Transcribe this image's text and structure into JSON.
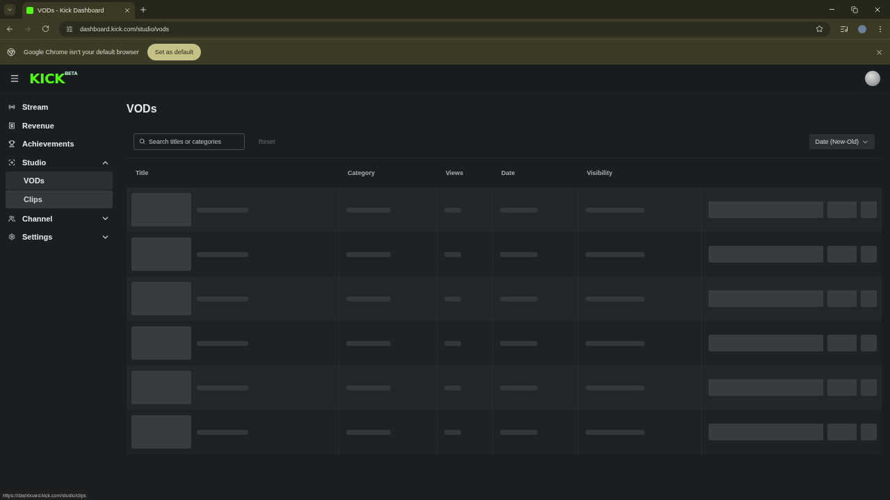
{
  "browser": {
    "tab": {
      "title": "VODs - Kick Dashboard",
      "selected": true
    },
    "url": "dashboard.kick.com/studio/vods",
    "infobar": {
      "message": "Google Chrome isn't your default browser",
      "button": "Set as default"
    },
    "status_url": "https://dashboard.kick.com/studio/clips"
  },
  "header": {
    "logo": "KICK",
    "logo_badge": "BETA"
  },
  "sidebar": {
    "items": [
      {
        "label": "Stream",
        "kind": "stream"
      },
      {
        "label": "Revenue",
        "kind": "revenue"
      },
      {
        "label": "Achievements",
        "kind": "achievements"
      },
      {
        "label": "Studio",
        "kind": "studio",
        "expanded": true,
        "children": [
          {
            "label": "VODs",
            "selected": true,
            "hovered": false
          },
          {
            "label": "Clips",
            "selected": false,
            "hovered": true
          }
        ]
      },
      {
        "label": "Channel",
        "kind": "channel",
        "expanded": false
      },
      {
        "label": "Settings",
        "kind": "settings",
        "expanded": false
      }
    ]
  },
  "page": {
    "title": "VODs",
    "search": {
      "placeholder": "Search titles or categories"
    },
    "reset": "Reset",
    "sort": "Date (New-Old)",
    "table": {
      "columns": [
        "Title",
        "Category",
        "Views",
        "Date",
        "Visibility"
      ],
      "rows": [
        {
          "kind": "skeleton"
        },
        {
          "kind": "skeleton"
        },
        {
          "kind": "skeleton"
        },
        {
          "kind": "skeleton"
        },
        {
          "kind": "skeleton"
        },
        {
          "kind": "skeleton"
        }
      ]
    }
  }
}
